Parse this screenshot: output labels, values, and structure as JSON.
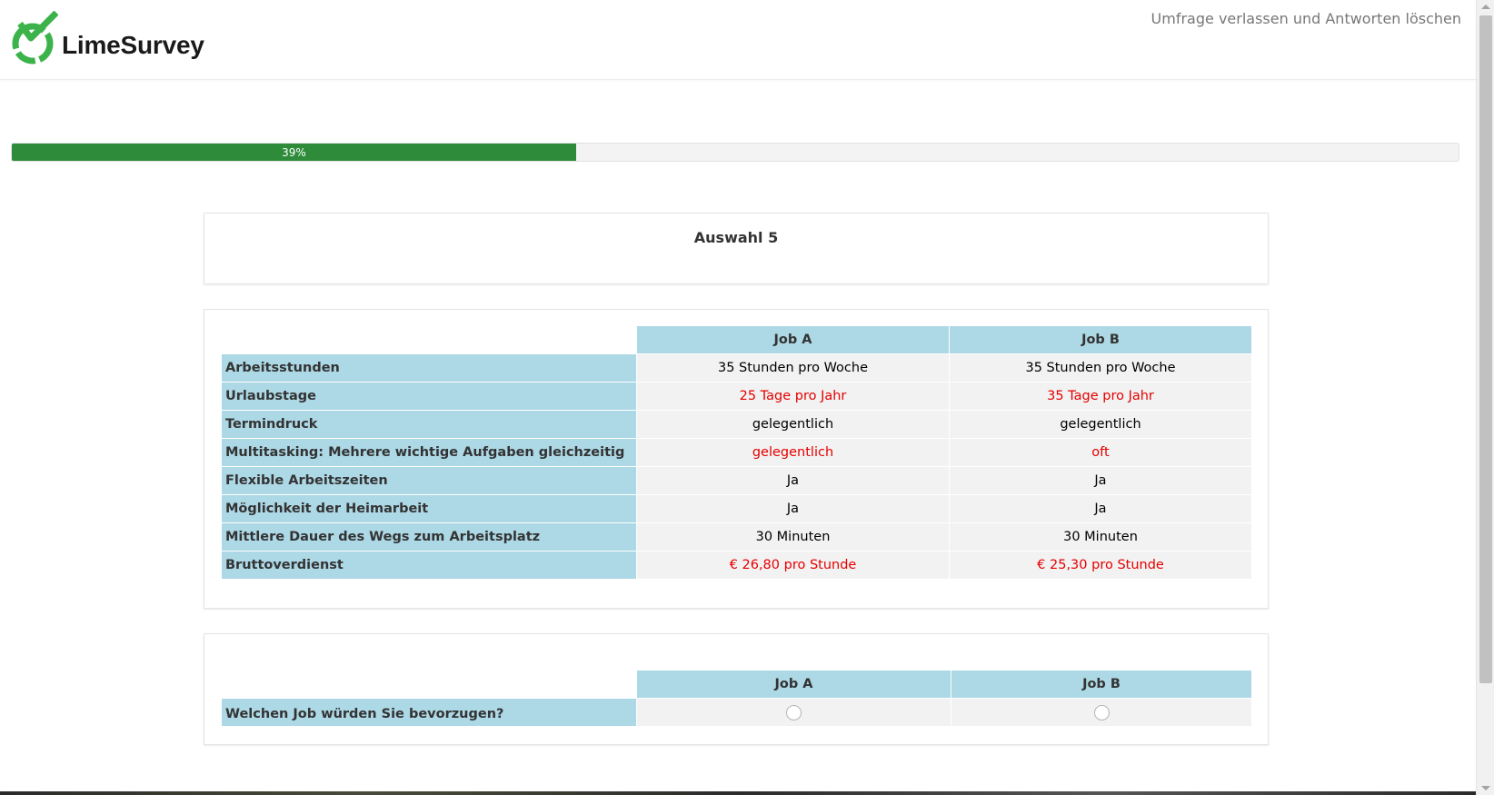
{
  "header": {
    "logo_text": "LimeSurvey",
    "exit_link": "Umfrage verlassen und Antworten löschen"
  },
  "progress": {
    "value_percent": 39,
    "label": "39%"
  },
  "group": {
    "title": "Auswahl 5"
  },
  "comparison": {
    "columns": [
      "Job A",
      "Job B"
    ],
    "rows": [
      {
        "label": "Arbeitsstunden",
        "job_a": "35 Stunden pro Woche",
        "job_b": "35 Stunden pro Woche",
        "highlight": false
      },
      {
        "label": "Urlaubstage",
        "job_a": "25 Tage pro Jahr",
        "job_b": "35 Tage pro Jahr",
        "highlight": true
      },
      {
        "label": "Termindruck",
        "job_a": "gelegentlich",
        "job_b": "gelegentlich",
        "highlight": false
      },
      {
        "label": "Multitasking: Mehrere wichtige Aufgaben gleichzeitig",
        "job_a": "gelegentlich",
        "job_b": "oft",
        "highlight": true
      },
      {
        "label": "Flexible Arbeitszeiten",
        "job_a": "Ja",
        "job_b": "Ja",
        "highlight": false
      },
      {
        "label": "Möglichkeit der Heimarbeit",
        "job_a": "Ja",
        "job_b": "Ja",
        "highlight": false
      },
      {
        "label": "Mittlere Dauer des Wegs zum Arbeitsplatz",
        "job_a": "30 Minuten",
        "job_b": "30 Minuten",
        "highlight": false
      },
      {
        "label": "Bruttoverdienst",
        "job_a": "€ 26,80 pro Stunde",
        "job_b": "€ 25,30 pro Stunde",
        "highlight": true
      }
    ]
  },
  "question": {
    "columns": [
      "Job A",
      "Job B"
    ],
    "text": "Welchen Job würden Sie bevorzugen?"
  },
  "colors": {
    "header_cell": "#add8e6",
    "value_cell": "#f2f2f2",
    "highlight_text": "#e60000",
    "progress_fill": "#2e8b3a"
  }
}
